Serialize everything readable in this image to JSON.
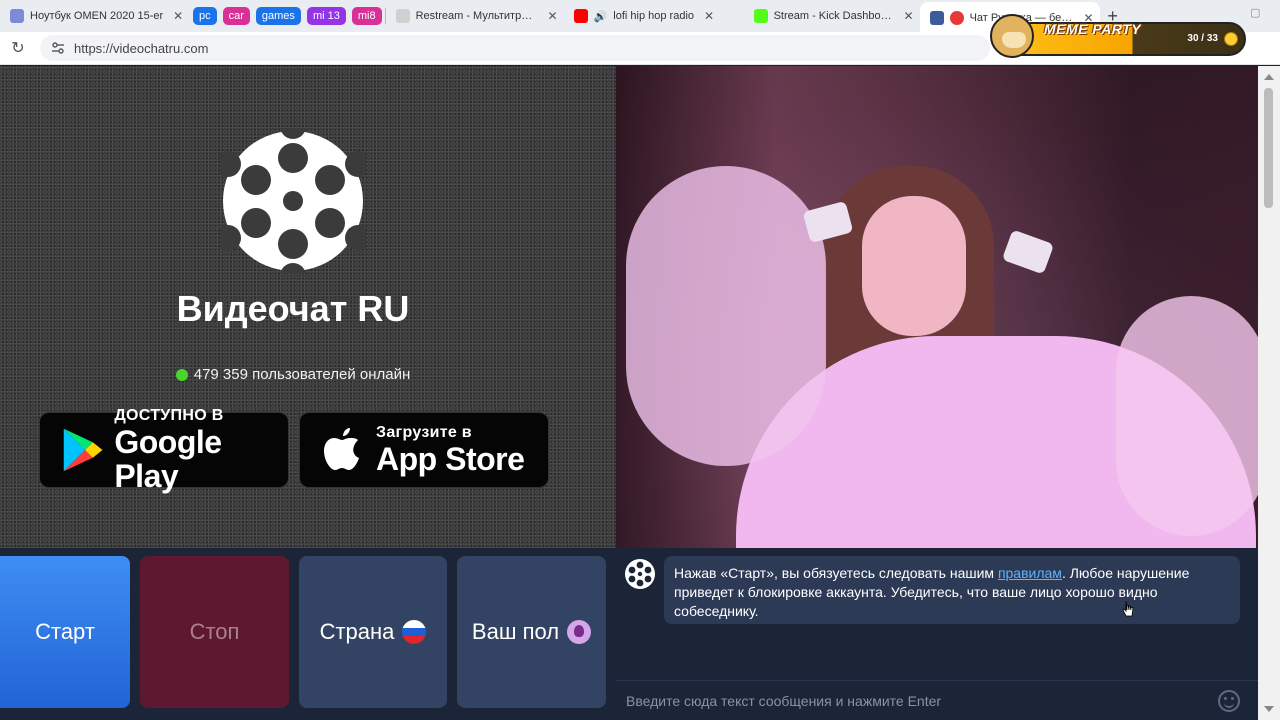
{
  "browser": {
    "tabs": [
      {
        "title": "Ноутбук OMEN 2020 15-er",
        "favicon_color": "#7b8bd8"
      },
      {
        "title": "Restream - Мультитрансля",
        "favicon_color": "#d0d0d0"
      },
      {
        "title": "lofi hip hop radio",
        "favicon_color": "#ff0000"
      },
      {
        "title": "Stream - Kick Dashboard",
        "favicon_color": "#53fc18"
      },
      {
        "title": "Чат Рулетка — беспл",
        "favicon_color": "#e53935"
      }
    ],
    "groups": [
      {
        "label": "pc",
        "color": "#1a73e8"
      },
      {
        "label": "car",
        "color": "#d93096"
      },
      {
        "label": "games",
        "color": "#1a73e8"
      },
      {
        "label": "mi 13",
        "color": "#9334e6"
      },
      {
        "label": "mi8",
        "color": "#d93096"
      }
    ],
    "url": "https://videochatru.com"
  },
  "extension_badge": {
    "title": "MEME PARTY",
    "count": "30 / 33"
  },
  "brand": {
    "title": "Видеочат RU",
    "online_text": "479 359 пользователей онлайн"
  },
  "stores": {
    "google_small": "ДОСТУПНО В",
    "google_big": "Google Play",
    "apple_small": "Загрузите в",
    "apple_big": "App Store"
  },
  "controls": {
    "start": "Старт",
    "stop": "Стоп",
    "country": "Страна",
    "gender": "Ваш пол"
  },
  "chat": {
    "message_before_link": "Нажав «Старт», вы обязуетесь следовать нашим ",
    "link_text": "правилам",
    "message_after_link": ". Любое нарушение приведет к блокировке аккаунта. Убедитесь, что ваше лицо хорошо видно собеседнику.",
    "input_placeholder": "Введите сюда текст сообщения и нажмите Enter"
  },
  "colors": {
    "start_button": "#2b74e2",
    "stop_button": "#5e1830",
    "secondary_button": "#324363",
    "online_indicator": "#49d62c",
    "link": "#5fb2ff"
  }
}
